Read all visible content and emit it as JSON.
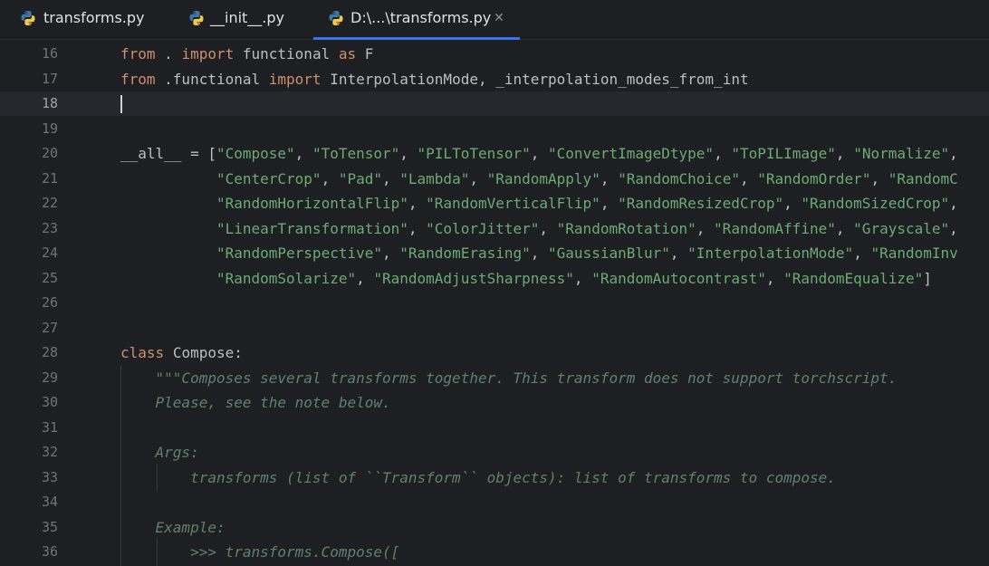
{
  "tabs": [
    {
      "label": "transforms.py",
      "active": false,
      "closable": false
    },
    {
      "label": "__init__.py",
      "active": false,
      "closable": false
    },
    {
      "label": "D:\\...\\transforms.py",
      "active": true,
      "closable": true
    }
  ],
  "tab_close_glyph": "✕",
  "editor": {
    "current_line": "18",
    "lines": [
      {
        "n": "16",
        "code": "from . import functional as F"
      },
      {
        "n": "17",
        "code": "from .functional import InterpolationMode, _interpolation_modes_from_int"
      },
      {
        "n": "18",
        "code": ""
      },
      {
        "n": "19",
        "code": ""
      },
      {
        "n": "20",
        "code": "__all__ = [\"Compose\", \"ToTensor\", \"PILToTensor\", \"ConvertImageDtype\", \"ToPILImage\", \"Normalize\","
      },
      {
        "n": "21",
        "code": "           \"CenterCrop\", \"Pad\", \"Lambda\", \"RandomApply\", \"RandomChoice\", \"RandomOrder\", \"RandomC"
      },
      {
        "n": "22",
        "code": "           \"RandomHorizontalFlip\", \"RandomVerticalFlip\", \"RandomResizedCrop\", \"RandomSizedCrop\","
      },
      {
        "n": "23",
        "code": "           \"LinearTransformation\", \"ColorJitter\", \"RandomRotation\", \"RandomAffine\", \"Grayscale\","
      },
      {
        "n": "24",
        "code": "           \"RandomPerspective\", \"RandomErasing\", \"GaussianBlur\", \"InterpolationMode\", \"RandomInv"
      },
      {
        "n": "25",
        "code": "           \"RandomSolarize\", \"RandomAdjustSharpness\", \"RandomAutocontrast\", \"RandomEqualize\"]"
      },
      {
        "n": "26",
        "code": ""
      },
      {
        "n": "27",
        "code": ""
      },
      {
        "n": "28",
        "code": "class Compose:"
      },
      {
        "n": "29",
        "code": "    \"\"\"Composes several transforms together. This transform does not support torchscript."
      },
      {
        "n": "30",
        "code": "    Please, see the note below."
      },
      {
        "n": "31",
        "code": ""
      },
      {
        "n": "32",
        "code": "    Args:"
      },
      {
        "n": "33",
        "code": "        transforms (list of ``Transform`` objects): list of transforms to compose."
      },
      {
        "n": "34",
        "code": ""
      },
      {
        "n": "35",
        "code": "    Example:"
      },
      {
        "n": "36",
        "code": "        >>> transforms.Compose(["
      }
    ]
  },
  "colors": {
    "background": "#1e1f22",
    "keyword": "#cf8e6d",
    "string": "#6aab73",
    "docstring": "#5f826b",
    "identifier": "#bcbec4",
    "line_number": "#6f737a",
    "active_tab_underline": "#3574f0",
    "current_line_bg": "#26282e"
  },
  "icons": {
    "tab_file_icon": "python-file-icon"
  }
}
